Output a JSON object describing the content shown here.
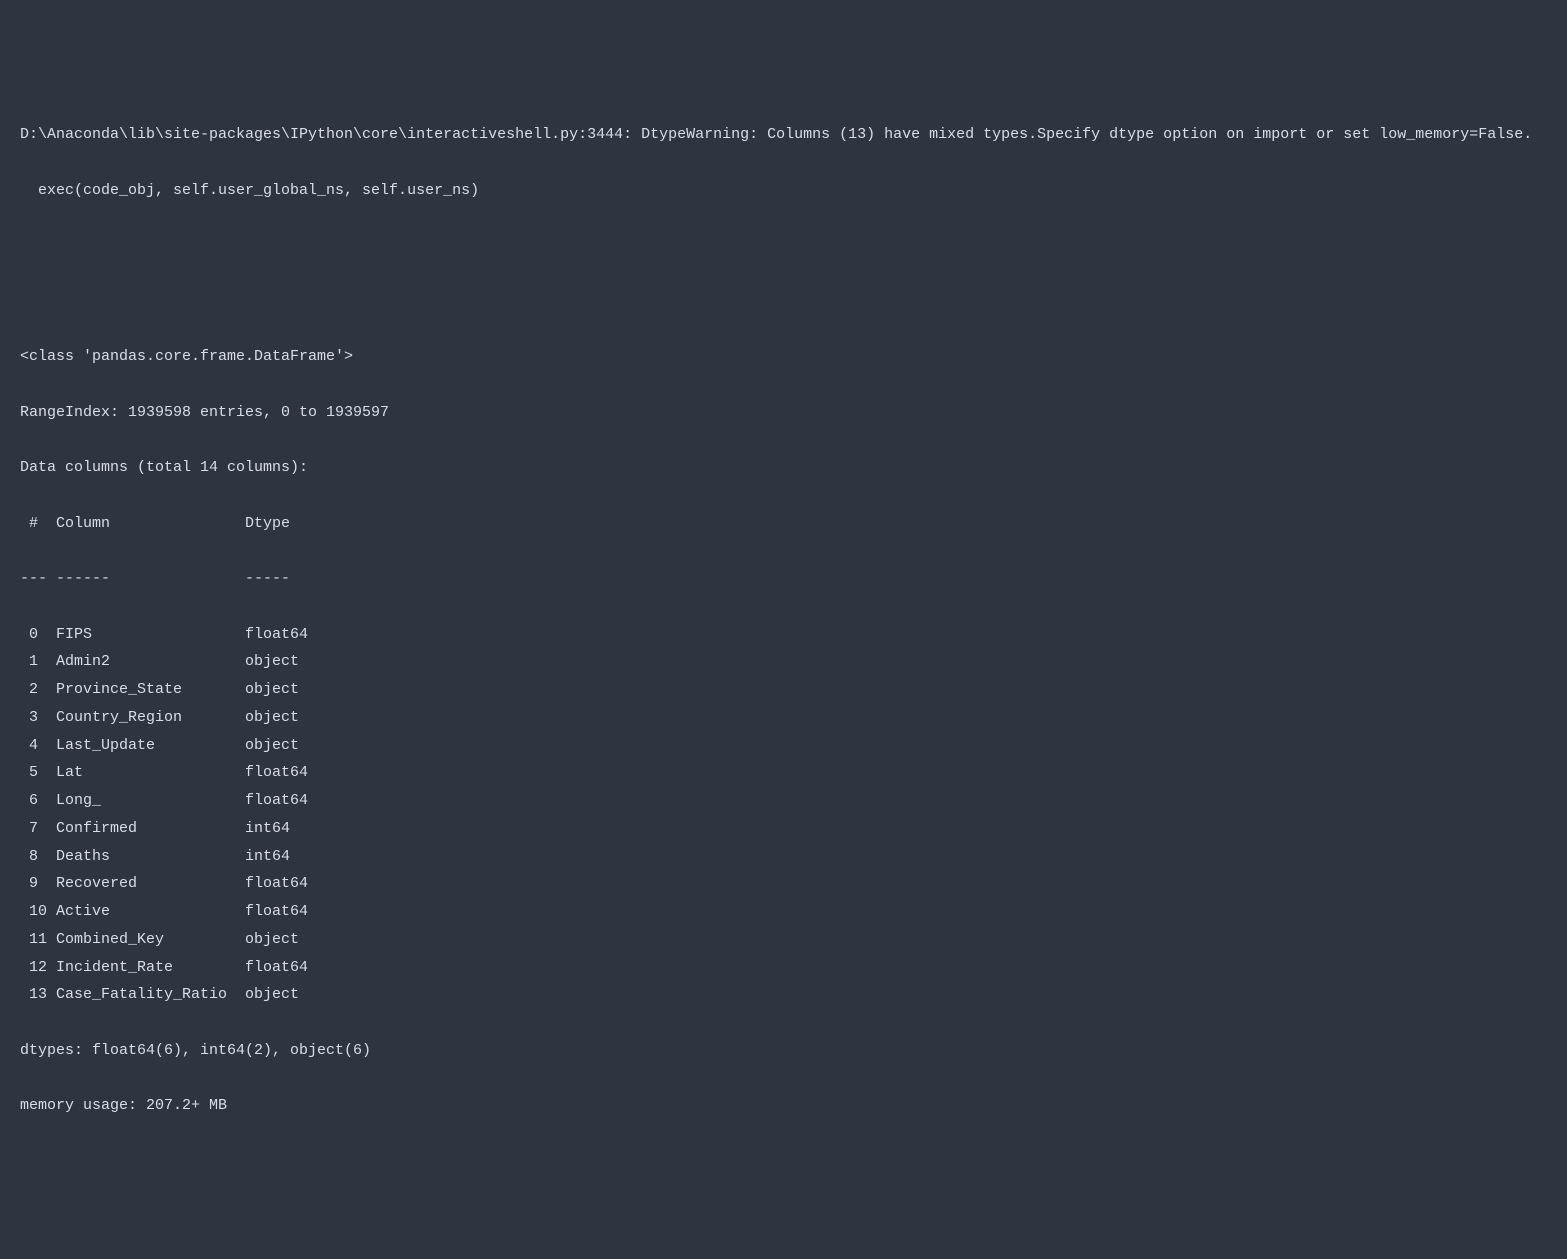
{
  "warning": {
    "line1": "D:\\Anaconda\\lib\\site-packages\\IPython\\core\\interactiveshell.py:3444: DtypeWarning: Columns (13) have mixed types.Specify dtype option on import or set low_memory=False.",
    "line2": "  exec(code_obj, self.user_global_ns, self.user_ns)"
  },
  "info": {
    "class_line": "<class 'pandas.core.frame.DataFrame'>",
    "range_index": "RangeIndex: 1939598 entries, 0 to 1939597",
    "data_columns_header": "Data columns (total 14 columns):",
    "header_idx": " #  ",
    "header_column": "Column               ",
    "header_dtype": "Dtype  ",
    "sep_idx": "--- ",
    "sep_column": "------               ",
    "sep_dtype": "-----  ",
    "columns": [
      {
        "idx": " 0  ",
        "name": "FIPS                 ",
        "dtype": "float64"
      },
      {
        "idx": " 1  ",
        "name": "Admin2               ",
        "dtype": "object "
      },
      {
        "idx": " 2  ",
        "name": "Province_State       ",
        "dtype": "object "
      },
      {
        "idx": " 3  ",
        "name": "Country_Region       ",
        "dtype": "object "
      },
      {
        "idx": " 4  ",
        "name": "Last_Update          ",
        "dtype": "object "
      },
      {
        "idx": " 5  ",
        "name": "Lat                  ",
        "dtype": "float64"
      },
      {
        "idx": " 6  ",
        "name": "Long_                ",
        "dtype": "float64"
      },
      {
        "idx": " 7  ",
        "name": "Confirmed            ",
        "dtype": "int64  "
      },
      {
        "idx": " 8  ",
        "name": "Deaths               ",
        "dtype": "int64  "
      },
      {
        "idx": " 9  ",
        "name": "Recovered            ",
        "dtype": "float64"
      },
      {
        "idx": " 10 ",
        "name": "Active               ",
        "dtype": "float64"
      },
      {
        "idx": " 11 ",
        "name": "Combined_Key         ",
        "dtype": "object "
      },
      {
        "idx": " 12 ",
        "name": "Incident_Rate        ",
        "dtype": "float64"
      },
      {
        "idx": " 13 ",
        "name": "Case_Fatality_Ratio  ",
        "dtype": "object "
      }
    ],
    "dtypes_summary": "dtypes: float64(6), int64(2), object(6)",
    "memory_usage": "memory usage: 207.2+ MB"
  }
}
